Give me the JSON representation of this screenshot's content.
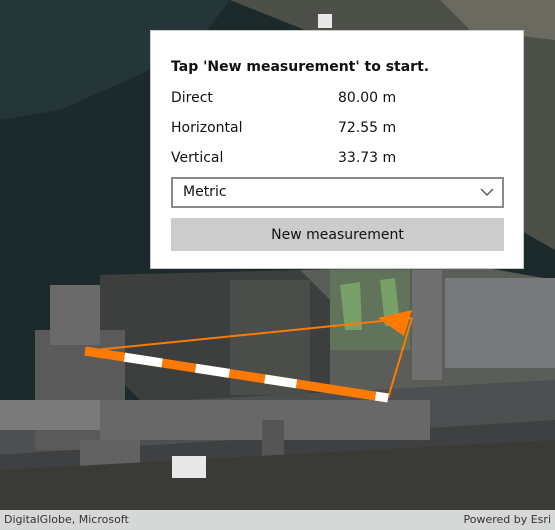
{
  "panel": {
    "instruction": "Tap 'New measurement' to start.",
    "rows": [
      {
        "label": "Direct",
        "value": "80.00 m"
      },
      {
        "label": "Horizontal",
        "value": "72.55 m"
      },
      {
        "label": "Vertical",
        "value": "33.73 m"
      }
    ],
    "unit_select": {
      "selected": "Metric"
    },
    "new_button_label": "New measurement"
  },
  "attribution": {
    "left": "DigitalGlobe, Microsoft",
    "right": "Powered by Esri"
  },
  "colors": {
    "measure_line": "#ff7a00",
    "measure_stripe": "#ffffff",
    "panel_bg": "#ffffff",
    "button_bg": "#cccccc"
  },
  "icons": {
    "dropdown": "chevron-down-icon"
  }
}
